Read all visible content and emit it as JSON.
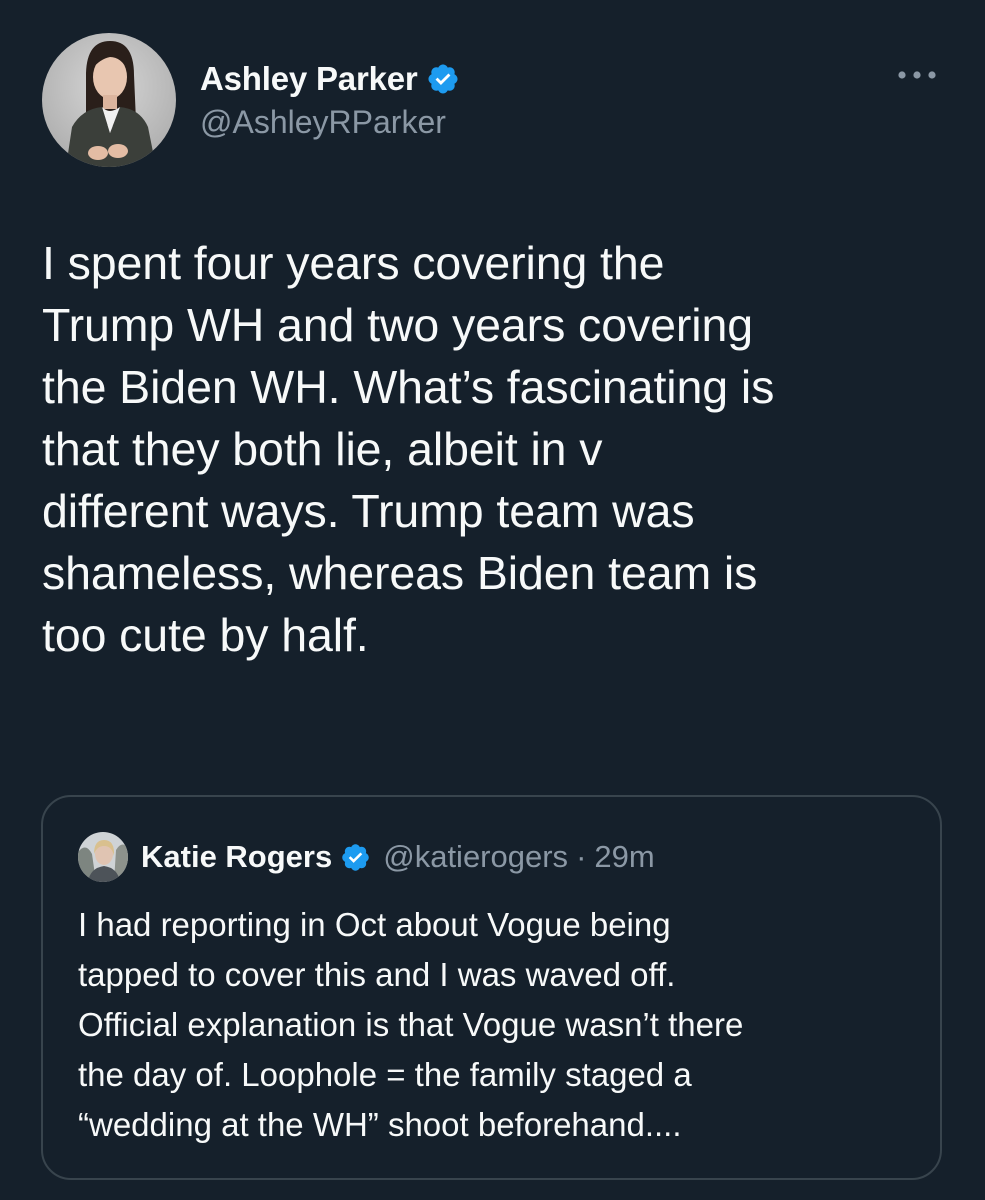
{
  "tweet": {
    "author": {
      "display_name": "Ashley Parker",
      "handle": "@AshleyRParker",
      "verified": true,
      "avatar_icon": "profile-photo"
    },
    "more_icon": "more-horizontal-icon",
    "text": "I spent four years covering the\nTrump WH and two years covering\nthe Biden WH. What’s fascinating is\nthat they both lie, albeit in v\ndifferent ways. Trump team was\nshameless, whereas Biden team is\ntoo cute by half.",
    "quoted": {
      "display_name": "Katie Rogers",
      "handle": "@katierogers",
      "separator": "·",
      "time": "29m",
      "verified": true,
      "text": "I had reporting in Oct about Vogue being\ntapped to cover this and I was waved off.\nOfficial explanation is that Vogue wasn’t there\nthe day of. Loophole = the family staged a\n“wedding at the WH” shoot beforehand...."
    }
  },
  "colors": {
    "background": "#15202b",
    "text_primary": "#f7f9f9",
    "text_secondary": "#8b98a5",
    "border": "#38444d",
    "verified_blue": "#1d9bf0"
  }
}
